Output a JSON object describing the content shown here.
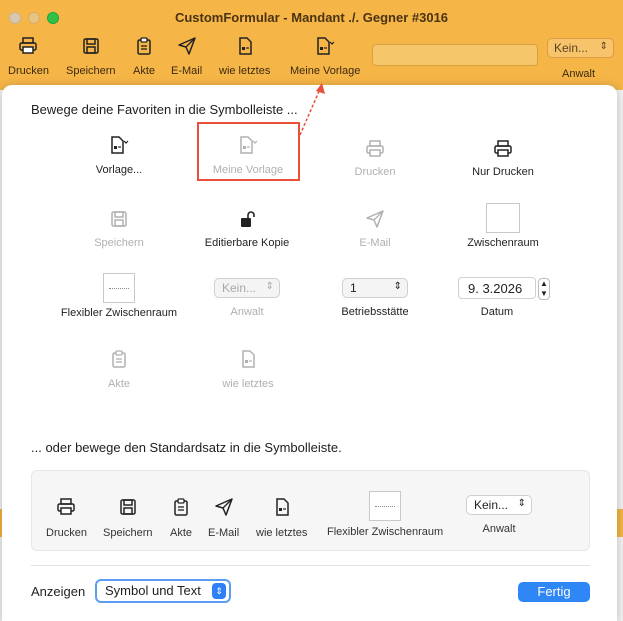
{
  "window": {
    "title": "CustomFormular -  Mandant ./. Gegner #3016"
  },
  "toolbar": {
    "items": [
      {
        "label": "Drucken",
        "icon": "printer-icon"
      },
      {
        "label": "Speichern",
        "icon": "save-disk-icon"
      },
      {
        "label": "Akte",
        "icon": "clipboard-icon"
      },
      {
        "label": "E-Mail",
        "icon": "paper-plane-icon"
      },
      {
        "label": "wie letztes",
        "icon": "document-icon"
      },
      {
        "label": "Meine Vorlage",
        "icon": "template-document-icon"
      }
    ],
    "select_value": "Kein...",
    "select_label": "Anwalt"
  },
  "sheet": {
    "heading": "Bewege deine Favoriten in die Symbolleiste ...",
    "palette": [
      {
        "label": "Vorlage...",
        "icon": "template-document-icon",
        "enabled": true
      },
      {
        "label": "Meine Vorlage",
        "icon": "template-document-icon",
        "enabled": false
      },
      {
        "label": "Drucken",
        "icon": "printer-icon",
        "enabled": false
      },
      {
        "label": "Nur Drucken",
        "icon": "printer-icon",
        "enabled": true
      },
      {
        "label": "Speichern",
        "icon": "save-disk-icon",
        "enabled": false
      },
      {
        "label": "Editierbare Kopie",
        "icon": "unlock-icon",
        "enabled": true
      },
      {
        "label": "E-Mail",
        "icon": "paper-plane-icon",
        "enabled": false
      },
      {
        "label": "Zwischenraum",
        "icon": "space-box",
        "enabled": true
      },
      {
        "label": "Flexibler Zwischenraum",
        "icon": "flexible-space-box",
        "enabled": true
      },
      {
        "label": "Anwalt",
        "value": "Kein...",
        "enabled": false
      },
      {
        "label": "Betriebsstätte",
        "value": "1",
        "enabled": true
      },
      {
        "label": "Datum",
        "value": "9. 3.2026",
        "enabled": true
      },
      {
        "label": "Akte",
        "icon": "clipboard-icon",
        "enabled": false
      },
      {
        "label": "wie letztes",
        "icon": "document-icon",
        "enabled": false
      }
    ],
    "standard_heading": "... oder bewege den Standardsatz in die Symbolleiste.",
    "standard_set": [
      {
        "label": "Drucken",
        "icon": "printer-icon"
      },
      {
        "label": "Speichern",
        "icon": "save-disk-icon"
      },
      {
        "label": "Akte",
        "icon": "clipboard-icon"
      },
      {
        "label": "E-Mail",
        "icon": "paper-plane-icon"
      },
      {
        "label": "wie letztes",
        "icon": "document-icon"
      },
      {
        "label": "Flexibler Zwischenraum",
        "icon": "flexible-space-box"
      },
      {
        "label": "Anwalt",
        "value": "Kein..."
      }
    ],
    "show_label": "Anzeigen",
    "show_value": "Symbol und Text",
    "done_label": "Fertig"
  },
  "colors": {
    "toolbar_bg": "#f5b547",
    "highlight": "#e8503a",
    "accent": "#2f86f5"
  }
}
